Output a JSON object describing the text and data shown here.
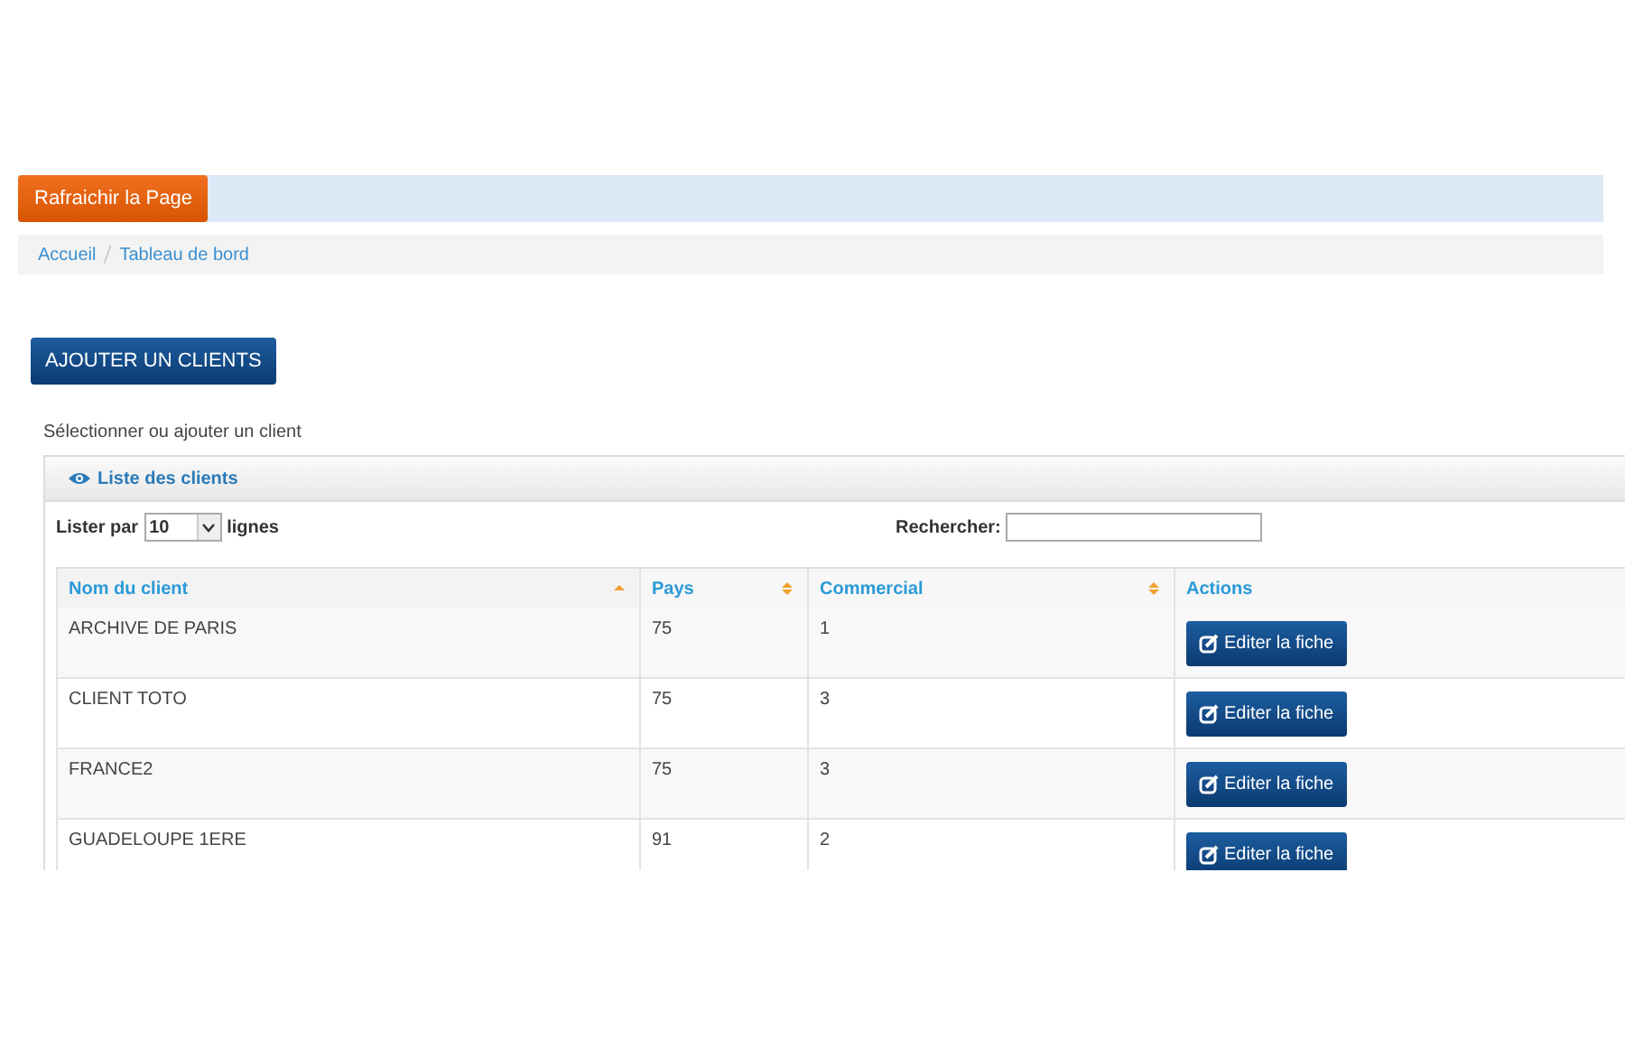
{
  "refresh_button": "Rafraichir la Page",
  "breadcrumb": [
    "Accueil",
    "Tableau de bord"
  ],
  "add_button": "AJOUTER UN CLIENTS",
  "intro": "Sélectionner ou ajouter un client",
  "panel": {
    "title": "Liste des clients",
    "length": {
      "before": "Lister par",
      "value": "10",
      "after": "lignes"
    },
    "search": {
      "label": "Rechercher:"
    },
    "columns": [
      {
        "label": "Nom du client",
        "sortable": true,
        "sorted": true
      },
      {
        "label": "Pays",
        "sortable": true,
        "sorted": false
      },
      {
        "label": "Commercial",
        "sortable": true,
        "sorted": false
      },
      {
        "label": "Actions",
        "sortable": false
      }
    ],
    "rows": [
      {
        "name": "ARCHIVE DE PARIS",
        "pays": "75",
        "commercial": "1",
        "action": "Editer la fiche"
      },
      {
        "name": "CLIENT TOTO",
        "pays": "75",
        "commercial": "3",
        "action": "Editer la fiche"
      },
      {
        "name": "FRANCE2",
        "pays": "75",
        "commercial": "3",
        "action": "Editer la fiche"
      },
      {
        "name": "GUADELOUPE 1ERE",
        "pays": "91",
        "commercial": "2",
        "action": "Editer la fiche"
      }
    ]
  }
}
